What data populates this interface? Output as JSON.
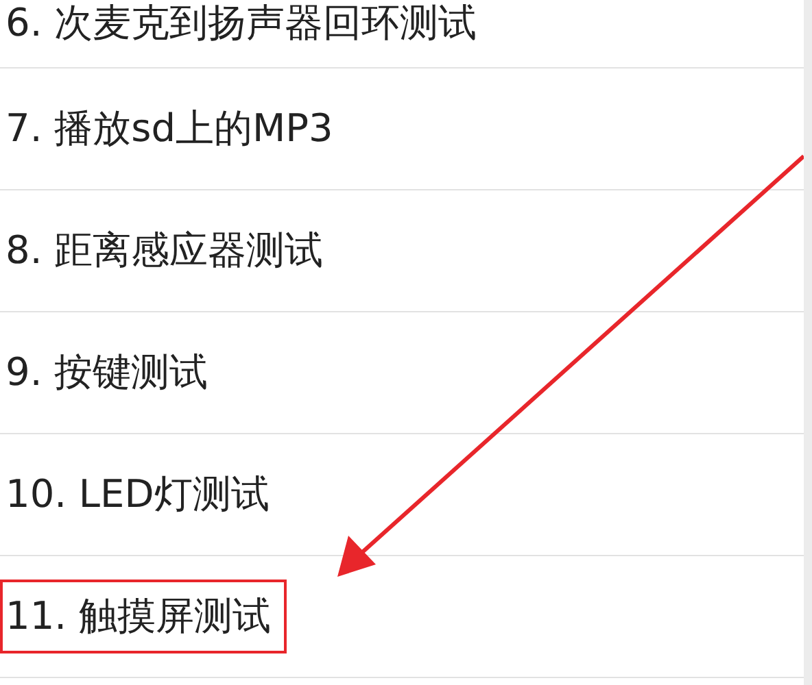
{
  "items": [
    {
      "label": "6. 次麦克到扬声器回环测试",
      "highlighted": false
    },
    {
      "label": "7. 播放sd上的MP3",
      "highlighted": false
    },
    {
      "label": "8. 距离感应器测试",
      "highlighted": false
    },
    {
      "label": "9. 按键测试",
      "highlighted": false
    },
    {
      "label": "10. LED灯测试",
      "highlighted": false
    },
    {
      "label": "11. 触摸屏测试",
      "highlighted": true
    }
  ]
}
